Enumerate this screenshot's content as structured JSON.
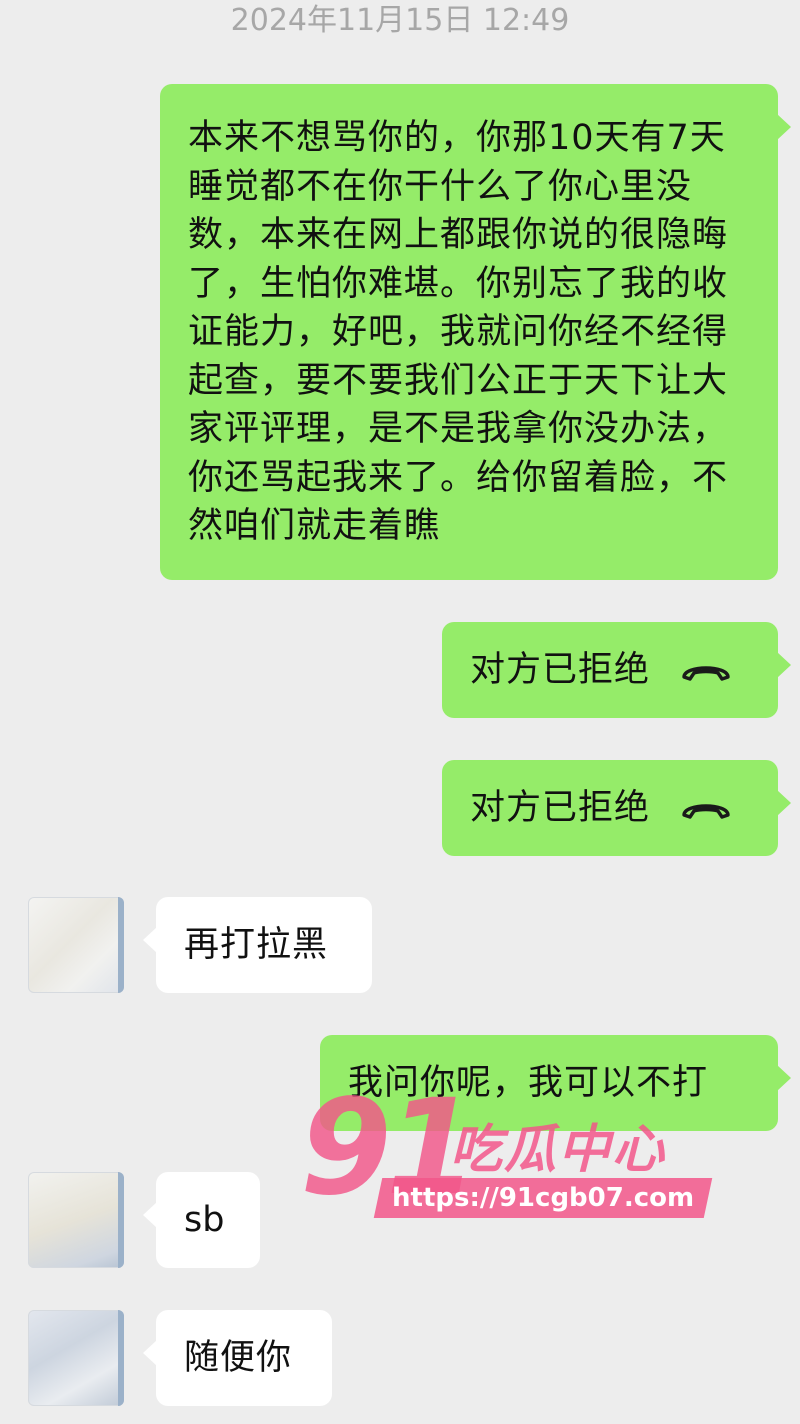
{
  "header": {
    "timestamp": "2024年11月15日 12:49"
  },
  "messages": [
    {
      "side": "out",
      "type": "text",
      "text": "本来不想骂你的，你那10天有7天睡觉都不在你干什么了你心里没数，本来在网上都跟你说的很隐晦了，生怕你难堪。你别忘了我的收证能力，好吧，我就问你经不经得起查，要不要我们公正于天下让大家评评理，是不是我拿你没办法，你还骂起我来了。给你留着脸，不然咱们就走着瞧"
    },
    {
      "side": "out",
      "type": "call",
      "text": "对方已拒绝",
      "icon": "hangup-phone-icon"
    },
    {
      "side": "out",
      "type": "call",
      "text": "对方已拒绝",
      "icon": "hangup-phone-icon"
    },
    {
      "side": "in",
      "type": "text",
      "text": "再打拉黑"
    },
    {
      "side": "out",
      "type": "text",
      "text": "我问你呢，我可以不打"
    },
    {
      "side": "in",
      "type": "text",
      "text": "sb"
    },
    {
      "side": "in",
      "type": "text",
      "text": "随便你"
    }
  ],
  "watermark": {
    "number": "91",
    "brand": "吃瓜中心",
    "url": "https://91cgb07.com"
  },
  "colors": {
    "background": "#ededed",
    "outgoing_bubble": "#95ec69",
    "incoming_bubble": "#ffffff",
    "timestamp": "#a7a7a7",
    "watermark": "#f25689"
  }
}
